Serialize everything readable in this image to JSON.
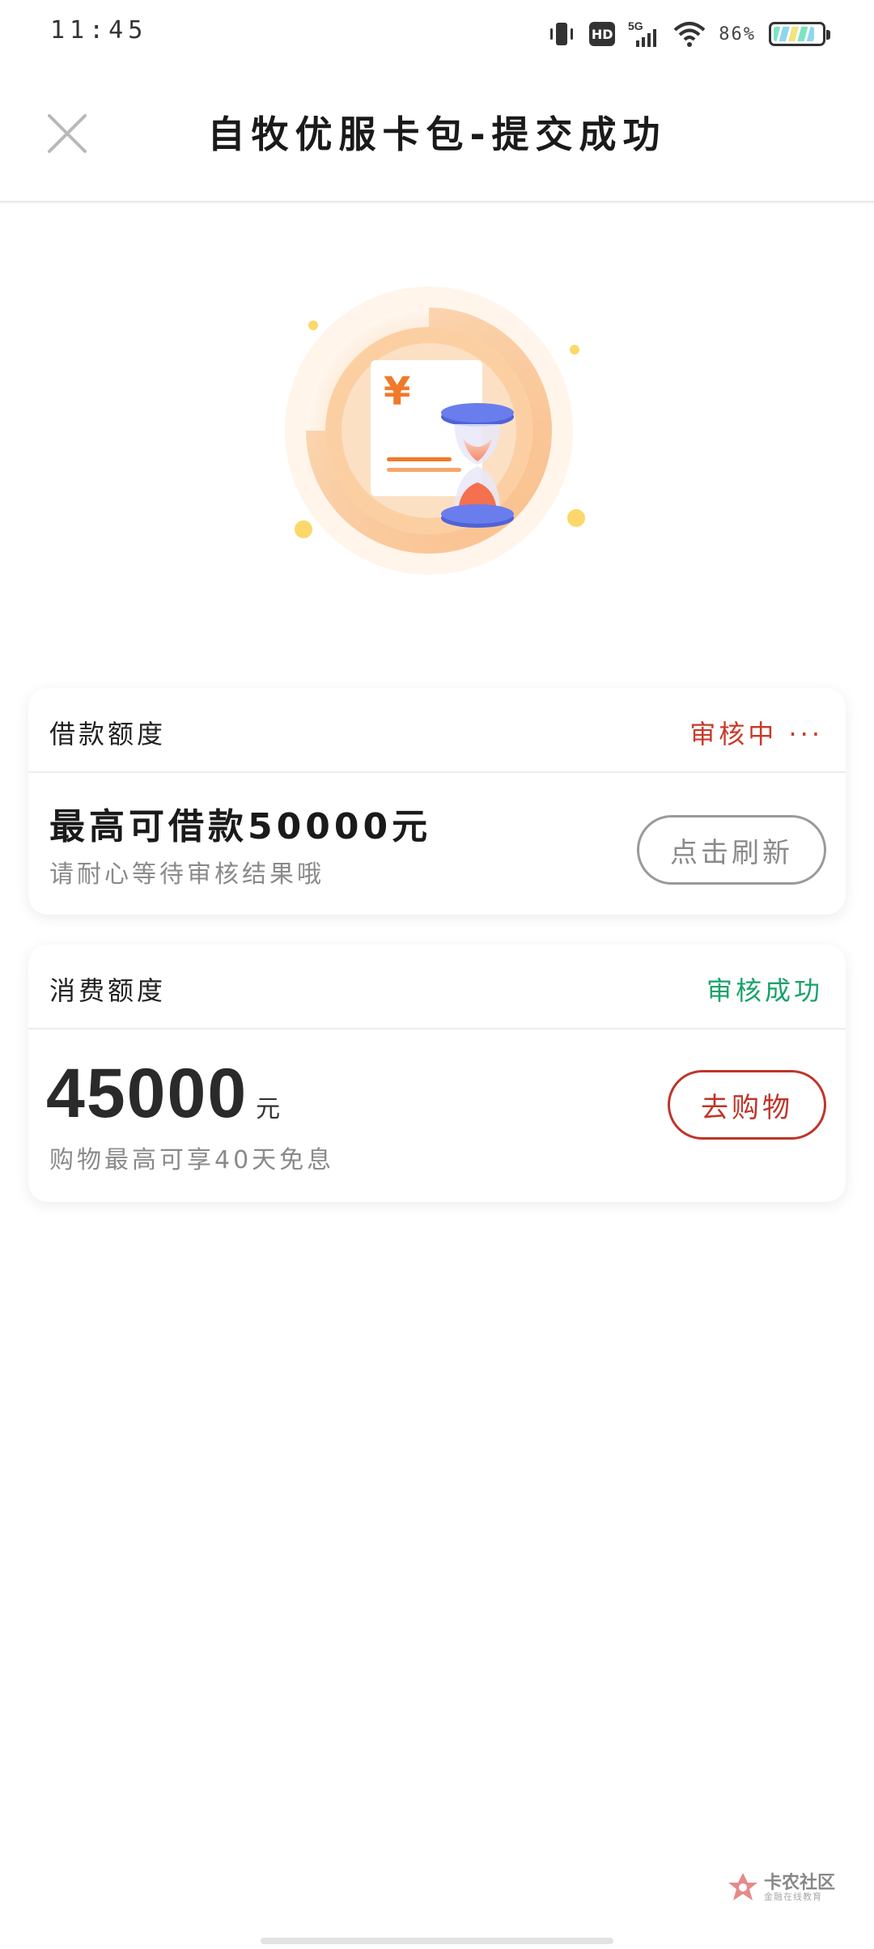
{
  "status_bar": {
    "time": "11:45",
    "network": "5G",
    "hd_label": "HD",
    "battery_text": "86%",
    "battery_level": 0.86
  },
  "header": {
    "title": "自牧优服卡包-提交成功"
  },
  "loan_card": {
    "label": "借款额度",
    "status": "审核中 ···",
    "title": "最高可借款50000元",
    "subtitle": "请耐心等待审核结果哦",
    "button_label": "点击刷新"
  },
  "consume_card": {
    "label": "消费额度",
    "status": "审核成功",
    "amount": "45000",
    "unit": "元",
    "subtitle": "购物最高可享40天免息",
    "button_label": "去购物"
  },
  "watermark": {
    "title": "卡农社区",
    "subtitle": "金融在线教育"
  },
  "colors": {
    "pending": "#c83a2a",
    "success": "#18a36a",
    "accent_red": "#c0342a",
    "illustration_orange": "#f59a4a",
    "hourglass_blue": "#5b6fe0"
  }
}
